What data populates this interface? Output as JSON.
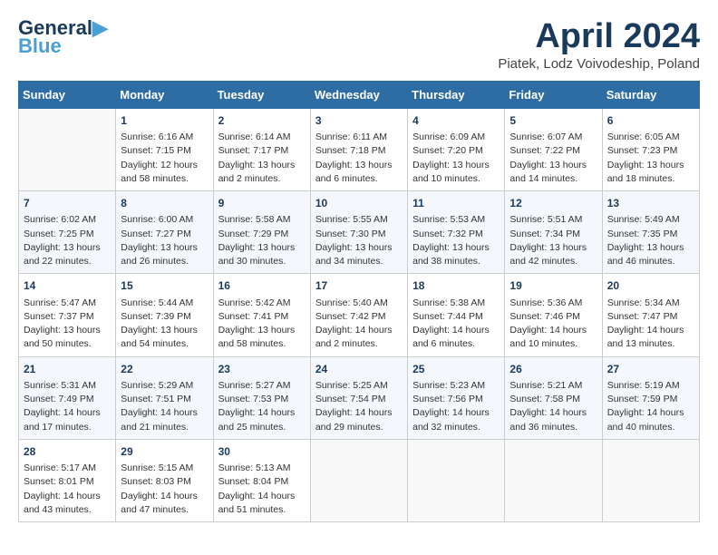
{
  "logo": {
    "line1": "General",
    "line2": "Blue"
  },
  "title": "April 2024",
  "subtitle": "Piatek, Lodz Voivodeship, Poland",
  "headers": [
    "Sunday",
    "Monday",
    "Tuesday",
    "Wednesday",
    "Thursday",
    "Friday",
    "Saturday"
  ],
  "weeks": [
    [
      {
        "day": "",
        "text": ""
      },
      {
        "day": "1",
        "text": "Sunrise: 6:16 AM\nSunset: 7:15 PM\nDaylight: 12 hours\nand 58 minutes."
      },
      {
        "day": "2",
        "text": "Sunrise: 6:14 AM\nSunset: 7:17 PM\nDaylight: 13 hours\nand 2 minutes."
      },
      {
        "day": "3",
        "text": "Sunrise: 6:11 AM\nSunset: 7:18 PM\nDaylight: 13 hours\nand 6 minutes."
      },
      {
        "day": "4",
        "text": "Sunrise: 6:09 AM\nSunset: 7:20 PM\nDaylight: 13 hours\nand 10 minutes."
      },
      {
        "day": "5",
        "text": "Sunrise: 6:07 AM\nSunset: 7:22 PM\nDaylight: 13 hours\nand 14 minutes."
      },
      {
        "day": "6",
        "text": "Sunrise: 6:05 AM\nSunset: 7:23 PM\nDaylight: 13 hours\nand 18 minutes."
      }
    ],
    [
      {
        "day": "7",
        "text": "Sunrise: 6:02 AM\nSunset: 7:25 PM\nDaylight: 13 hours\nand 22 minutes."
      },
      {
        "day": "8",
        "text": "Sunrise: 6:00 AM\nSunset: 7:27 PM\nDaylight: 13 hours\nand 26 minutes."
      },
      {
        "day": "9",
        "text": "Sunrise: 5:58 AM\nSunset: 7:29 PM\nDaylight: 13 hours\nand 30 minutes."
      },
      {
        "day": "10",
        "text": "Sunrise: 5:55 AM\nSunset: 7:30 PM\nDaylight: 13 hours\nand 34 minutes."
      },
      {
        "day": "11",
        "text": "Sunrise: 5:53 AM\nSunset: 7:32 PM\nDaylight: 13 hours\nand 38 minutes."
      },
      {
        "day": "12",
        "text": "Sunrise: 5:51 AM\nSunset: 7:34 PM\nDaylight: 13 hours\nand 42 minutes."
      },
      {
        "day": "13",
        "text": "Sunrise: 5:49 AM\nSunset: 7:35 PM\nDaylight: 13 hours\nand 46 minutes."
      }
    ],
    [
      {
        "day": "14",
        "text": "Sunrise: 5:47 AM\nSunset: 7:37 PM\nDaylight: 13 hours\nand 50 minutes."
      },
      {
        "day": "15",
        "text": "Sunrise: 5:44 AM\nSunset: 7:39 PM\nDaylight: 13 hours\nand 54 minutes."
      },
      {
        "day": "16",
        "text": "Sunrise: 5:42 AM\nSunset: 7:41 PM\nDaylight: 13 hours\nand 58 minutes."
      },
      {
        "day": "17",
        "text": "Sunrise: 5:40 AM\nSunset: 7:42 PM\nDaylight: 14 hours\nand 2 minutes."
      },
      {
        "day": "18",
        "text": "Sunrise: 5:38 AM\nSunset: 7:44 PM\nDaylight: 14 hours\nand 6 minutes."
      },
      {
        "day": "19",
        "text": "Sunrise: 5:36 AM\nSunset: 7:46 PM\nDaylight: 14 hours\nand 10 minutes."
      },
      {
        "day": "20",
        "text": "Sunrise: 5:34 AM\nSunset: 7:47 PM\nDaylight: 14 hours\nand 13 minutes."
      }
    ],
    [
      {
        "day": "21",
        "text": "Sunrise: 5:31 AM\nSunset: 7:49 PM\nDaylight: 14 hours\nand 17 minutes."
      },
      {
        "day": "22",
        "text": "Sunrise: 5:29 AM\nSunset: 7:51 PM\nDaylight: 14 hours\nand 21 minutes."
      },
      {
        "day": "23",
        "text": "Sunrise: 5:27 AM\nSunset: 7:53 PM\nDaylight: 14 hours\nand 25 minutes."
      },
      {
        "day": "24",
        "text": "Sunrise: 5:25 AM\nSunset: 7:54 PM\nDaylight: 14 hours\nand 29 minutes."
      },
      {
        "day": "25",
        "text": "Sunrise: 5:23 AM\nSunset: 7:56 PM\nDaylight: 14 hours\nand 32 minutes."
      },
      {
        "day": "26",
        "text": "Sunrise: 5:21 AM\nSunset: 7:58 PM\nDaylight: 14 hours\nand 36 minutes."
      },
      {
        "day": "27",
        "text": "Sunrise: 5:19 AM\nSunset: 7:59 PM\nDaylight: 14 hours\nand 40 minutes."
      }
    ],
    [
      {
        "day": "28",
        "text": "Sunrise: 5:17 AM\nSunset: 8:01 PM\nDaylight: 14 hours\nand 43 minutes."
      },
      {
        "day": "29",
        "text": "Sunrise: 5:15 AM\nSunset: 8:03 PM\nDaylight: 14 hours\nand 47 minutes."
      },
      {
        "day": "30",
        "text": "Sunrise: 5:13 AM\nSunset: 8:04 PM\nDaylight: 14 hours\nand 51 minutes."
      },
      {
        "day": "",
        "text": ""
      },
      {
        "day": "",
        "text": ""
      },
      {
        "day": "",
        "text": ""
      },
      {
        "day": "",
        "text": ""
      }
    ]
  ]
}
